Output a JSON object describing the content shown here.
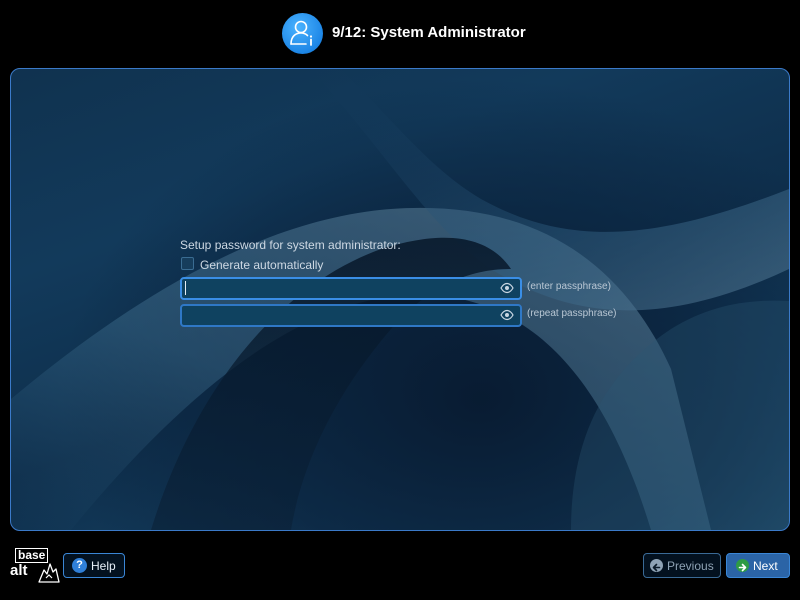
{
  "header": {
    "title": "9/12: System Administrator",
    "icon": "user-info-icon"
  },
  "form": {
    "setup_label": "Setup password for system administrator:",
    "generate_checkbox": {
      "label": "Generate automatically",
      "checked": false
    },
    "password_field": {
      "value": "",
      "hint": "(enter passphrase)",
      "toggle_icon": "eye-icon"
    },
    "repeat_field": {
      "value": "",
      "hint": "(repeat passphrase)",
      "toggle_icon": "eye-icon"
    }
  },
  "footer": {
    "logo": {
      "top": "base",
      "bottom": "alt"
    },
    "help_label": "Help",
    "previous_label": "Previous",
    "next_label": "Next"
  },
  "colors": {
    "accent": "#3a8ee6",
    "background": "#000000",
    "next_button": "#2b64a6",
    "next_arrow": "#2e9b45"
  }
}
